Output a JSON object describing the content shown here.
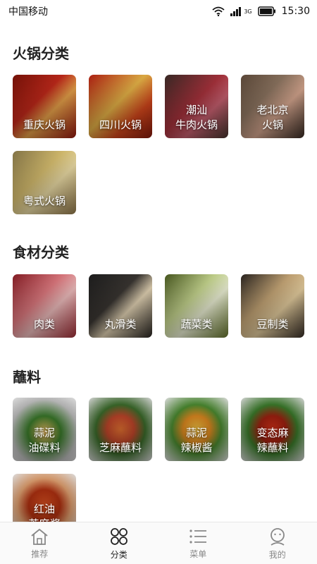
{
  "status_bar": {
    "carrier": "中国移动",
    "network": "3G",
    "time": "15:30"
  },
  "sections": [
    {
      "title": "火锅分类",
      "items": [
        {
          "label": "重庆火锅",
          "bg": "linear-gradient(135deg,#7a1208 0%,#c0281a 40%,#e8a24a 60%,#9e1b10 100%)"
        },
        {
          "label": "四川火锅",
          "bg": "linear-gradient(135deg,#b52012 0%,#e6b347 45%,#d4471c 70%,#8a1a0c 100%)"
        },
        {
          "label": "潮汕\n牛肉火锅",
          "bg": "linear-gradient(135deg,#3a2a26 0%,#a8323c 45%,#c86070 65%,#4a3630 100%)"
        },
        {
          "label": "老北京\n火锅",
          "bg": "linear-gradient(135deg,#5e4a3a 0%,#8c7460 35%,#d8a890 60%,#3a2c24 100%)"
        },
        {
          "label": "粤式火锅",
          "bg": "linear-gradient(135deg,#8a7a4a 0%,#d9c070 40%,#f0e0a8 60%,#9a8050 100%)"
        }
      ]
    },
    {
      "title": "食材分类",
      "items": [
        {
          "label": "肉类",
          "bg": "linear-gradient(135deg,#8a1e26 0%,#e07a80 40%,#f2c0c0 60%,#a8303a 100%)"
        },
        {
          "label": "丸滑类",
          "bg": "linear-gradient(135deg,#1e1e1e 0%,#3a3632 40%,#e8d8b8 60%,#2a2622 100%)"
        },
        {
          "label": "蔬菜类",
          "bg": "linear-gradient(135deg,#4a5a20 0%,#c8d890 40%,#f0f4d8 60%,#6a7a30 100%)"
        },
        {
          "label": "豆制类",
          "bg": "linear-gradient(135deg,#2a2420 0%,#c8a878 40%,#e8d0a0 60%,#3a3028 100%)"
        }
      ]
    },
    {
      "title": "蘸料",
      "items": [
        {
          "label": "蒜泥\n油碟料",
          "bg": "radial-gradient(circle at 50% 55%,#e8b860 0%,#3a7a2a 35%,#c0c0c0 70%,#e8e8e8 100%)"
        },
        {
          "label": "芝麻蘸料",
          "bg": "radial-gradient(circle at 50% 50%,#e07030 0%,#c0452a 30%,#3a6a2a 55%,#e0e0e0 100%)"
        },
        {
          "label": "蒜泥\n辣椒酱",
          "bg": "radial-gradient(circle at 50% 50%,#f0c040 0%,#e08a20 30%,#4a8a30 55%,#e8e8e8 100%)"
        },
        {
          "label": "变态麻\n辣蘸料",
          "bg": "radial-gradient(circle at 50% 50%,#d03018 0%,#a02010 30%,#3a7a2a 55%,#e0e0e0 100%)"
        },
        {
          "label": "红油\n芝麻酱",
          "bg": "radial-gradient(circle at 50% 50%,#d85020 0%,#b03010 35%,#e0a070 60%,#e8e8e8 100%)"
        }
      ]
    }
  ],
  "tabbar": [
    {
      "label": "推荐",
      "icon": "home-icon",
      "active": false
    },
    {
      "label": "分类",
      "icon": "category-icon",
      "active": true
    },
    {
      "label": "菜单",
      "icon": "list-icon",
      "active": false
    },
    {
      "label": "我的",
      "icon": "profile-icon",
      "active": false
    }
  ],
  "colors": {
    "active_tab": "#222222",
    "inactive_tab": "#888888",
    "divider": "#e6e6e6"
  }
}
